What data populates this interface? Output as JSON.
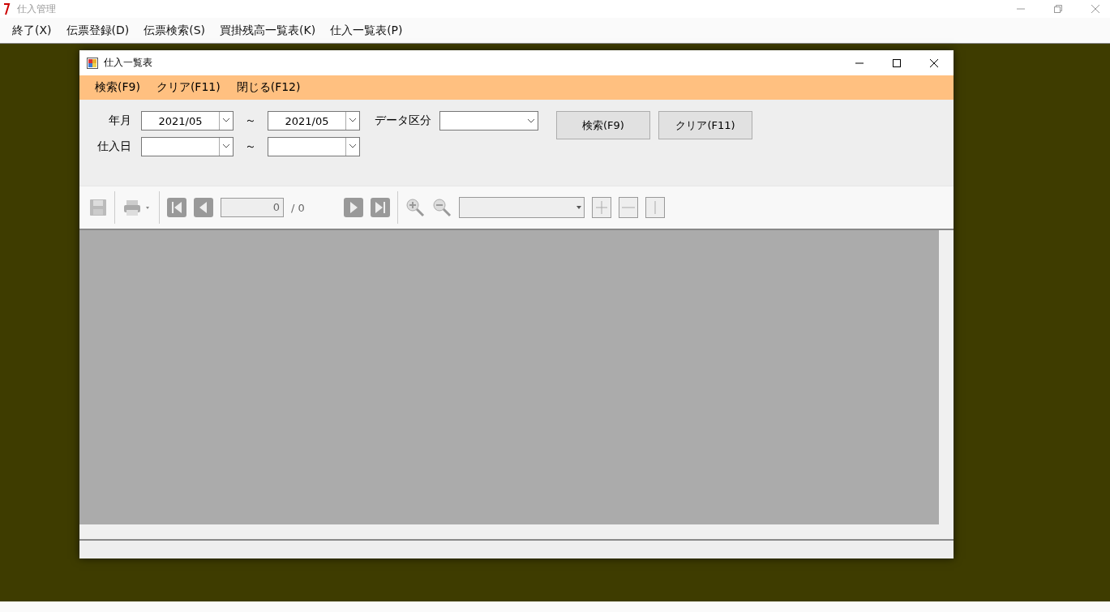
{
  "window": {
    "title": "仕入管理"
  },
  "menu": [
    "終了(X)",
    "伝票登録(D)",
    "伝票検索(S)",
    "買掛残高一覧表(K)",
    "仕入一覧表(P)"
  ],
  "child": {
    "title": "仕入一覧表",
    "menu": [
      "検索(F9)",
      "クリア(F11)",
      "閉じる(F12)"
    ],
    "form": {
      "year_month": {
        "label": "年月",
        "from": "2021/05",
        "sep": "～",
        "to": "2021/05"
      },
      "data_type": {
        "label": "データ区分"
      },
      "purchase_date": {
        "label": "仕入日",
        "sep": "～"
      },
      "buttons": [
        "検索(F9)",
        "クリア(F11)"
      ]
    },
    "toolbar": {
      "page": "0",
      "total": "/ 0"
    }
  }
}
